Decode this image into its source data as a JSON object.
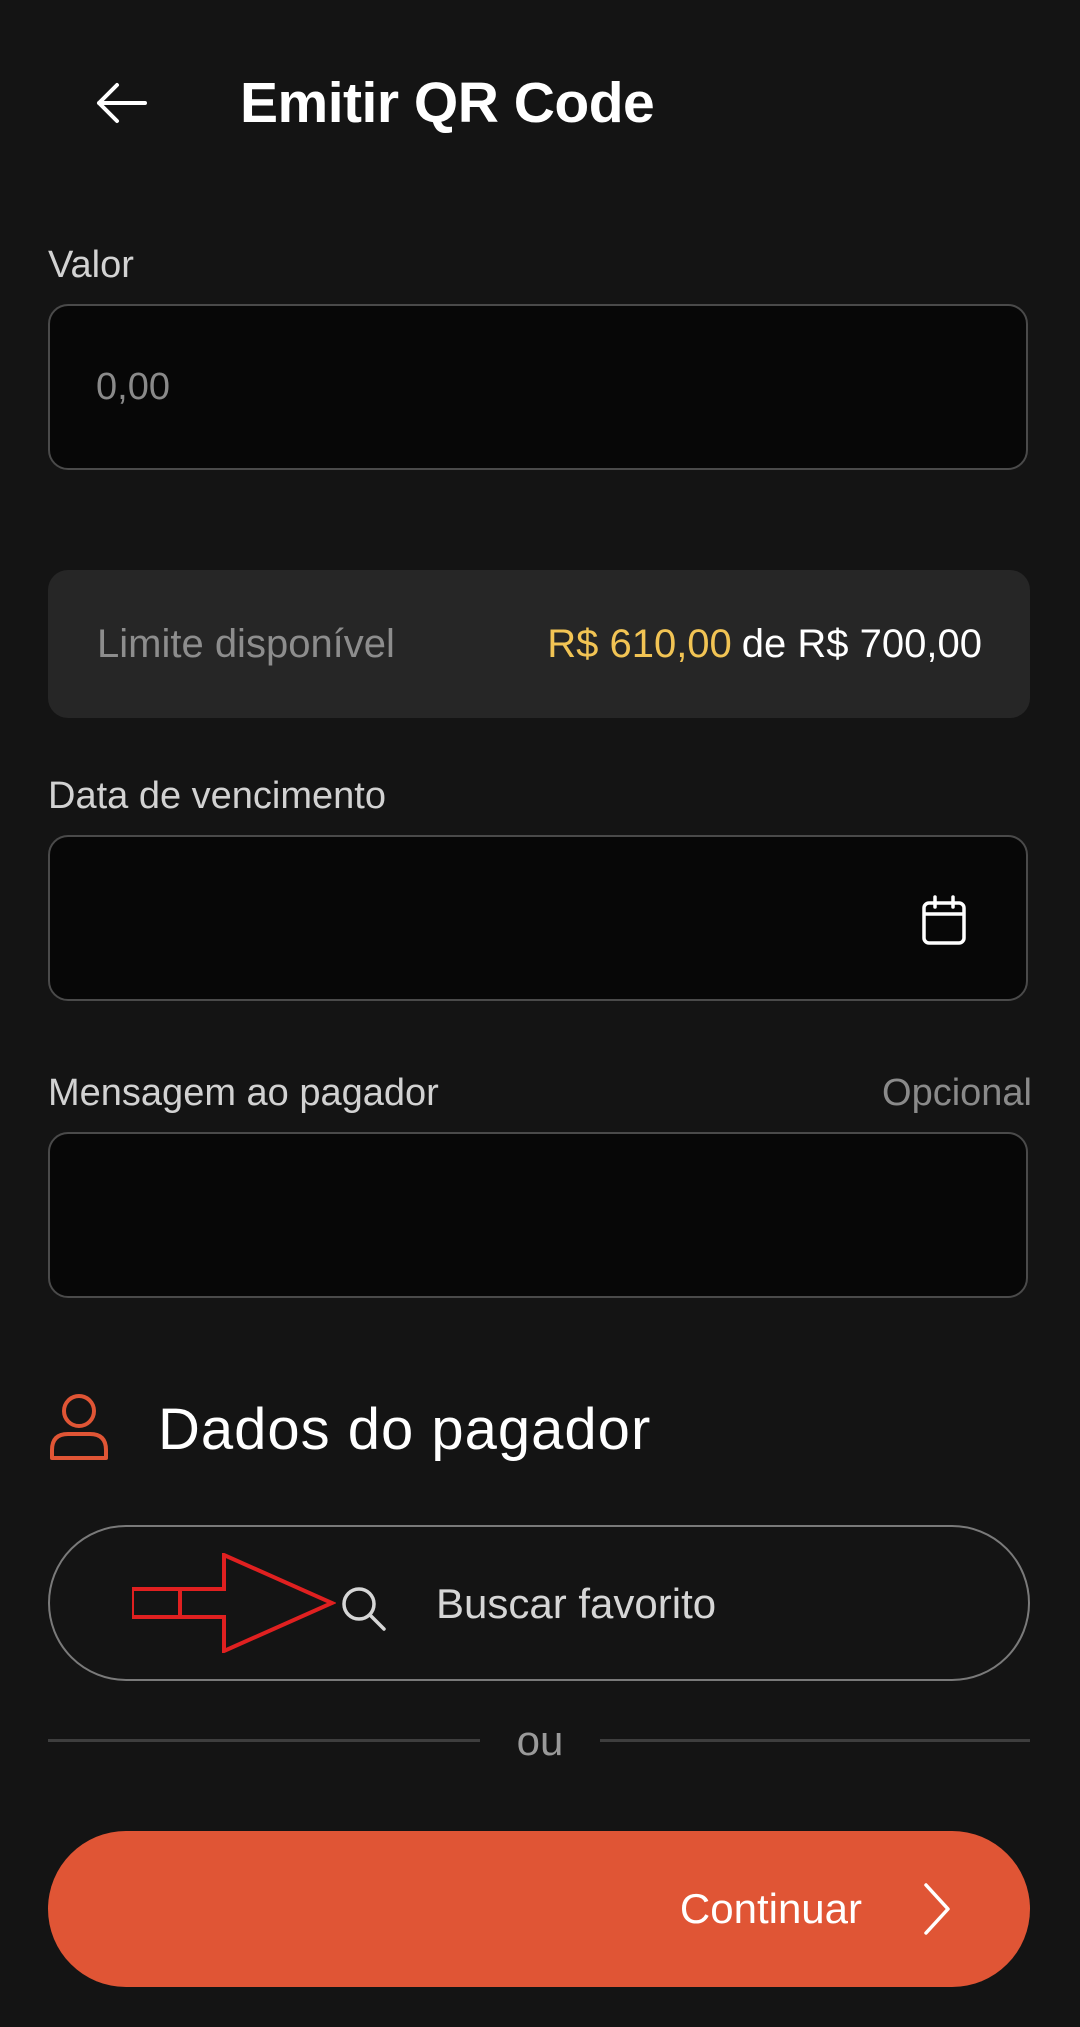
{
  "header": {
    "title": "Emitir QR Code",
    "back_icon": "arrow-left-icon"
  },
  "value_field": {
    "label": "Valor",
    "placeholder": "0,00",
    "value": ""
  },
  "limit": {
    "label": "Limite disponível",
    "available": "R$ 610,00",
    "total": "de R$ 700,00",
    "available_color": "#f2c454"
  },
  "due_date_field": {
    "label": "Data de vencimento",
    "value": "",
    "icon": "calendar-icon"
  },
  "message_field": {
    "label": "Mensagem ao pagador",
    "optional_label": "Opcional",
    "value": ""
  },
  "payer_section": {
    "title": "Dados do pagador",
    "icon": "person-icon",
    "accent_color": "#e05535"
  },
  "search": {
    "label": "Buscar favorito",
    "icon": "search-icon",
    "annotation": "red-arrow-icon"
  },
  "divider": {
    "text": "ou"
  },
  "continue_button": {
    "label": "Continuar",
    "icon": "chevron-right-icon",
    "color": "#e05535"
  }
}
